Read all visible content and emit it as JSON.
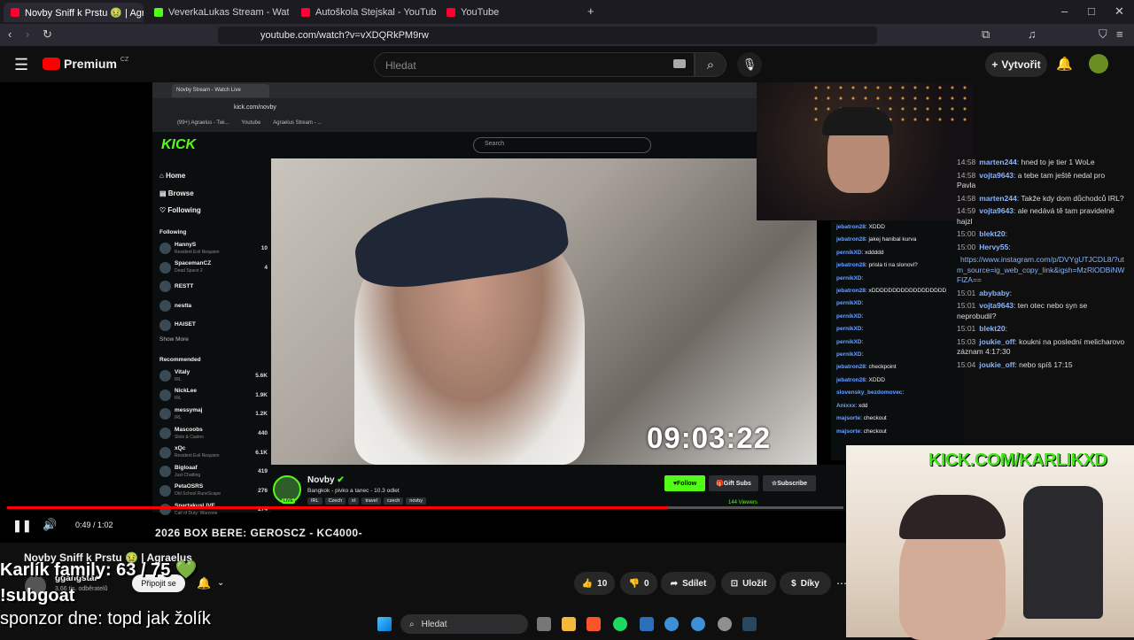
{
  "browser": {
    "tabs": [
      {
        "label": "Novby Sniff k Prstu 🤢 | Agra",
        "active": true,
        "color": "#ff0033"
      },
      {
        "label": "VeverkaLukas Stream - Watch Live or",
        "active": false,
        "color": "#53fc18"
      },
      {
        "label": "Autoškola Stejskal - YouTube",
        "active": false,
        "color": "#ff0033"
      },
      {
        "label": "YouTube",
        "active": false,
        "color": "#ff0033"
      }
    ],
    "url": "youtube.com/watch?v=vXDQRkPM9rw"
  },
  "youtube": {
    "logo": "Premium",
    "region": "CZ",
    "search_placeholder": "Hledat",
    "create_label": "Vytvořit",
    "accent": "#ff0000"
  },
  "kick": {
    "url": "kick.com/novby",
    "bookmarks": [
      "(99+) Agraelus - Twi...",
      "Youtube",
      "Agraelus Stream - ..."
    ],
    "logo": "KICK",
    "search_placeholder": "Search",
    "nav": [
      "Home",
      "Browse",
      "Following"
    ],
    "following_title": "Following",
    "following": [
      {
        "name": "HannyS",
        "game": "Resident Evil Requiem",
        "count": "10"
      },
      {
        "name": "SpacemanCZ",
        "game": "Dead Space 2",
        "count": "4"
      },
      {
        "name": "RESTT",
        "game": "",
        "count": ""
      },
      {
        "name": "nestta",
        "game": "",
        "count": ""
      },
      {
        "name": "HAISET",
        "game": "",
        "count": ""
      }
    ],
    "show_more": "Show More",
    "recommended_title": "Recommended",
    "recommended": [
      {
        "name": "Vitaly",
        "game": "IRL",
        "count": "5.6K"
      },
      {
        "name": "NickLee",
        "game": "IRL",
        "count": "1.9K"
      },
      {
        "name": "messymaj",
        "game": "IRL",
        "count": "1.2K"
      },
      {
        "name": "Mascoobs",
        "game": "Slots & Casino",
        "count": "440"
      },
      {
        "name": "xQc",
        "game": "Resident Evil Requiem",
        "count": "6.1K"
      },
      {
        "name": "Bigloaaf",
        "game": "Just Chatting",
        "count": "419"
      },
      {
        "name": "PetaOSRS",
        "game": "Old School RuneScape",
        "count": "276"
      },
      {
        "name": "SpartakusLIVE",
        "game": "Call of Duty: Warzone",
        "count": "274"
      }
    ],
    "timer": "09:03:22",
    "streamer": "Novby",
    "stream_title": "Bangkok - pivko a tanec - 10.3 odlet",
    "tags": [
      "IRL",
      "Czech",
      "irl",
      "travel",
      "czech",
      "novby"
    ],
    "follow": "Follow",
    "gift_subs": "Gift Subs",
    "subscribe": "Subscribe",
    "viewers": "144 Viewers",
    "live_badge": "LIVE",
    "chat": [
      {
        "user": "jebatron28",
        "msg": ": XDDD"
      },
      {
        "user": "jebatron28",
        "msg": ": jakej hanibal kurva"
      },
      {
        "user": "pernikXD",
        "msg": ": xddddd"
      },
      {
        "user": "jebatron28",
        "msg": ": prisla ti na slonovi?"
      },
      {
        "user": "pernikXD",
        "msg": ":"
      },
      {
        "user": "jebatron28",
        "msg": ": xDDDDDDDDDDDDDDDDDD"
      },
      {
        "user": "pernikXD",
        "msg": ":"
      },
      {
        "user": "pernikXD",
        "msg": ":"
      },
      {
        "user": "pernikXD",
        "msg": ":"
      },
      {
        "user": "pernikXD",
        "msg": ":"
      },
      {
        "user": "pernikXD",
        "msg": ":"
      },
      {
        "user": "jebatron28",
        "msg": ": checkpoint"
      },
      {
        "user": "jebatron28",
        "msg": ": XDDD"
      },
      {
        "user": "slovensky_bezdomovec",
        "msg": ":"
      },
      {
        "user": "Anixxx",
        "msg": ": xdd"
      },
      {
        "user": "majsorte",
        "msg": ": checkout"
      },
      {
        "user": "majsorte",
        "msg": ": checkout"
      }
    ]
  },
  "ytchat": [
    {
      "time": "14:58",
      "user": "marten244",
      "msg": ": hned to je tier 1 WoLe"
    },
    {
      "time": "14:58",
      "user": "vojta9643",
      "msg": ": a tebe tam ještě nedal pro Pavla"
    },
    {
      "time": "14:58",
      "user": "marten244",
      "msg": ": Takže kdy dom důchodců IRL?"
    },
    {
      "time": "14:59",
      "user": "vojta9643",
      "msg": ": ale nedává tě tam pravidelně hajzl"
    },
    {
      "time": "15:00",
      "user": "blekt20",
      "msg": ":"
    },
    {
      "time": "15:00",
      "user": "Hervy55",
      "msg": ":"
    },
    {
      "time": "",
      "user": "",
      "msg": "https://www.instagram.com/p/DVYgUTJCDL8/?utm_source=ig_web_copy_link&igsh=MzRlODBiNWFlZA=="
    },
    {
      "time": "15:01",
      "user": "abybaby",
      "msg": ":"
    },
    {
      "time": "15:01",
      "user": "vojta9643",
      "msg": ": ten otec nebo syn se neprobudil?"
    },
    {
      "time": "15:01",
      "user": "blekt20",
      "msg": ":"
    },
    {
      "time": "15:03",
      "user": "joukie_off",
      "msg": ": koukni na poslední melicharovo záznam 4:17:30"
    },
    {
      "time": "15:04",
      "user": "joukie_off",
      "msg": ": nebo spíš 17:15"
    }
  ],
  "webcam": {
    "overlay": "KICK.COM/KARLIKXD"
  },
  "player": {
    "current": "0:49",
    "duration": "1:02",
    "progress_fraction": 0.79,
    "ticker": "2026 BOX BERE: GEROSCZ - KC4000-"
  },
  "video": {
    "title": "Novby Sniff k Prstu 🤢 | Agraelus",
    "channel": "ggangstar",
    "subs": "3,66 tis. odběratelů",
    "join": "Připojit se",
    "likes": "10",
    "dislikes": "0",
    "share": "Sdílet",
    "save": "Uložit",
    "thanks": "Díky"
  },
  "overlays": {
    "line1": "Karlík family: 63 / 75 💚",
    "line2": "!subgoat",
    "line3": "sponzor dne: topd jak žolík"
  },
  "taskbar": {
    "search": "Hledat"
  }
}
